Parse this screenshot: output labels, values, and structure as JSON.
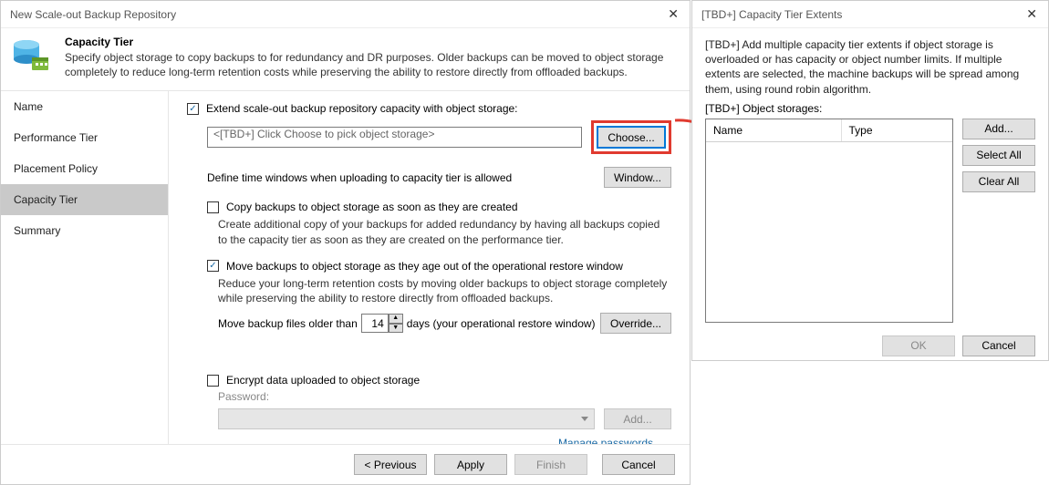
{
  "leftDialog": {
    "title": "New Scale-out Backup Repository",
    "header": {
      "heading": "Capacity Tier",
      "description": "Specify object storage to copy backups to for redundancy and DR purposes. Older backups can be moved to object storage completely to reduce long-term retention costs while preserving the ability to restore directly from offloaded backups."
    },
    "nav": {
      "items": [
        {
          "label": "Name",
          "selected": false
        },
        {
          "label": "Performance Tier",
          "selected": false
        },
        {
          "label": "Placement Policy",
          "selected": false
        },
        {
          "label": "Capacity Tier",
          "selected": true
        },
        {
          "label": "Summary",
          "selected": false
        }
      ]
    },
    "content": {
      "extendCheckboxLabel": "Extend scale-out backup repository capacity with object storage:",
      "extendChecked": true,
      "objectStorageValue": "<[TBD+] Click Choose to pick object storage>",
      "chooseBtn": "Choose...",
      "timeWindowLabel": "Define time windows when uploading to capacity tier is allowed",
      "windowBtn": "Window...",
      "copyCheckboxLabel": "Copy backups to object storage as soon as they are created",
      "copyChecked": false,
      "copyDesc": "Create additional copy of your backups for added redundancy by having all backups copied to the capacity tier as soon as they are created on the performance tier.",
      "moveCheckboxLabel": "Move backups to object storage as they age out of the operational restore window",
      "moveChecked": true,
      "moveDesc": "Reduce your long-term retention costs by moving older backups to object storage completely while preserving the ability to restore directly from offloaded backups.",
      "moveOlderPrefix": "Move backup files older than",
      "moveOlderValue": "14",
      "moveOlderSuffix": "days (your operational restore window)",
      "overrideBtn": "Override...",
      "encryptCheckboxLabel": "Encrypt data uploaded to object storage",
      "encryptChecked": false,
      "passwordLabel": "Password:",
      "addPwBtn": "Add...",
      "managePw": "Manage passwords"
    },
    "footer": {
      "prev": "< Previous",
      "apply": "Apply",
      "finish": "Finish",
      "cancel": "Cancel"
    }
  },
  "rightDialog": {
    "title": "[TBD+] Capacity Tier Extents",
    "description": "[TBD+] Add multiple capacity tier extents if object storage is overloaded or has capacity or object number limits. If multiple extents are selected, the machine backups will be spread among them, using round robin algorithm.",
    "listLabel": "[TBD+] Object storages:",
    "columns": {
      "name": "Name",
      "type": "Type"
    },
    "buttons": {
      "add": "Add...",
      "selectAll": "Select All",
      "clearAll": "Clear All"
    },
    "footer": {
      "ok": "OK",
      "cancel": "Cancel"
    }
  }
}
